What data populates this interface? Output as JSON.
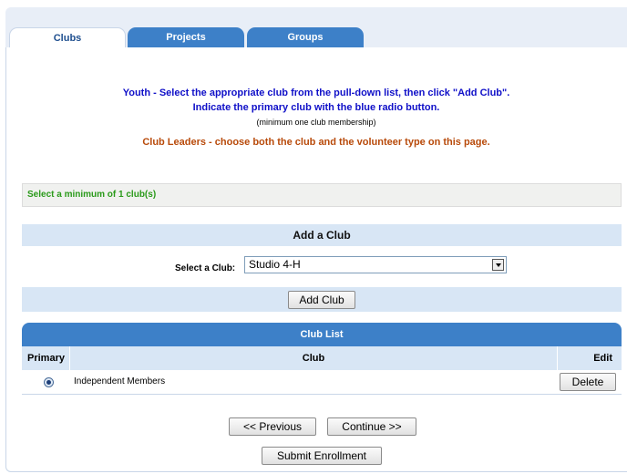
{
  "tabs": [
    {
      "label": "Clubs"
    },
    {
      "label": "Projects"
    },
    {
      "label": "Groups"
    }
  ],
  "instructions": {
    "youth_line1": "Youth - Select the appropriate club from the pull-down list, then click \"Add Club\".",
    "youth_line2": "Indicate the primary club with the blue radio button.",
    "minimum_note": "(minimum one club membership)",
    "leaders_line": "Club Leaders - choose both the club and the volunteer type on this page."
  },
  "notice": "Select a minimum of 1 club(s)",
  "add_club": {
    "title": "Add a Club",
    "select_label": "Select a Club:",
    "selected_value": "Studio 4-H",
    "button_label": "Add Club"
  },
  "club_list": {
    "title": "Club List",
    "columns": {
      "primary": "Primary",
      "club": "Club",
      "edit": "Edit"
    },
    "rows": [
      {
        "club": "Independent Members",
        "action": "Delete",
        "primary": true
      }
    ]
  },
  "navigation": {
    "previous_label": "<< Previous",
    "continue_label": "Continue >>",
    "submit_label": "Submit Enrollment"
  },
  "colors": {
    "tab_blue": "#3d80c8",
    "band_light": "#d8e6f5",
    "instruction_blue": "#1010c8",
    "leaders_orange": "#b84a0a",
    "notice_green": "#2a9a1a"
  }
}
